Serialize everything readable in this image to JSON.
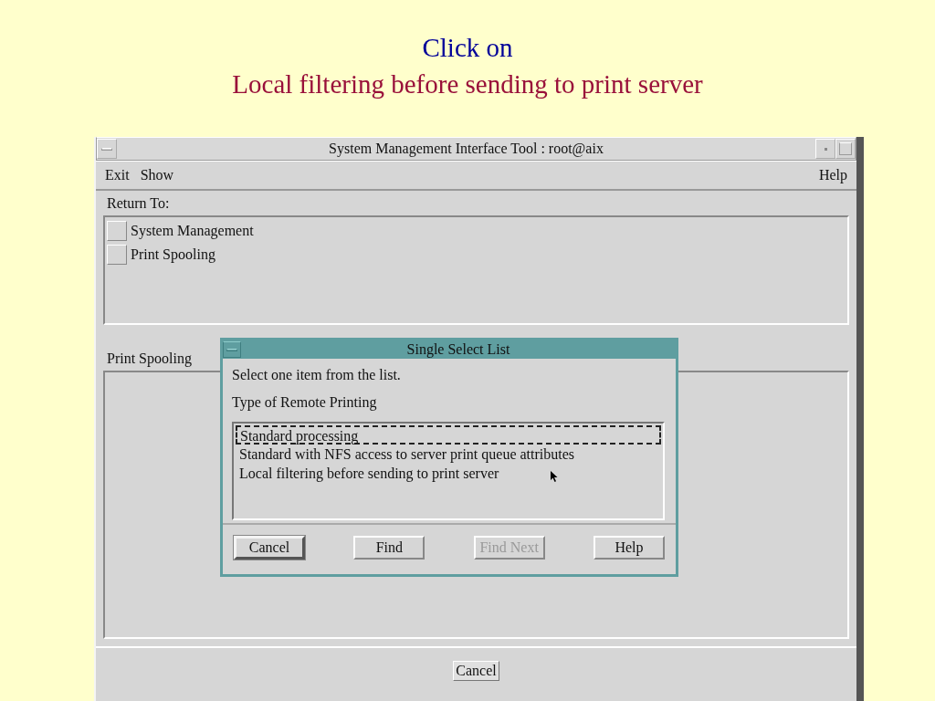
{
  "slide": {
    "heading": "Click on",
    "subheading": "Local filtering before sending to print server"
  },
  "window": {
    "title": "System Management Interface Tool : root@aix",
    "menu": [
      {
        "label": "Exit"
      },
      {
        "label": "Show"
      },
      {
        "label": "Help"
      }
    ],
    "return_to": {
      "label": "Return To:",
      "items": [
        "System Management",
        "Print Spooling"
      ]
    },
    "section": {
      "label": "Print Spooling"
    },
    "buttons": [
      {
        "label": "Cancel"
      }
    ]
  },
  "dialog": {
    "title": "Single Select List",
    "instruction": "Select one item from the list.",
    "list_label": "Type of Remote Printing",
    "items": [
      {
        "label": "Standard processing",
        "focused": true,
        "selected": false
      },
      {
        "label": "Standard with NFS access to server print queue attributes",
        "focused": false,
        "selected": false
      },
      {
        "label": "Local filtering before sending to print server",
        "focused": false,
        "selected": false
      }
    ],
    "buttons": [
      {
        "label": "Cancel",
        "default": true,
        "disabled": false
      },
      {
        "label": "Find",
        "default": false,
        "disabled": false
      },
      {
        "label": "Find Next",
        "default": false,
        "disabled": true
      },
      {
        "label": "Help",
        "default": false,
        "disabled": false
      }
    ]
  }
}
